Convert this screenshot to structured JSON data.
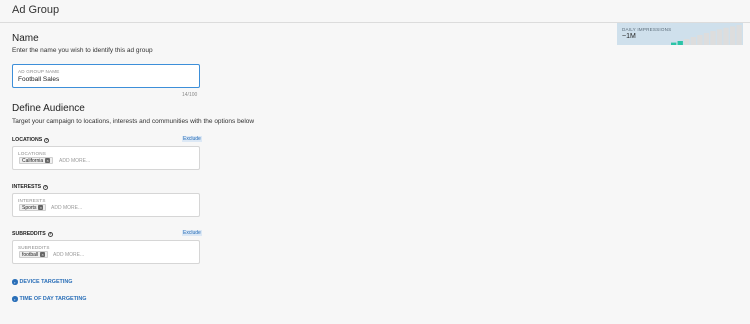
{
  "header": {
    "title": "Ad Group"
  },
  "name_section": {
    "title": "Name",
    "description": "Enter the name you wish to identify this ad group",
    "input": {
      "label": "AD GROUP NAME",
      "value": "Football Sales",
      "char_count": "14/100"
    }
  },
  "audience_section": {
    "title": "Define Audience",
    "description": "Target your campaign to locations, interests and communities with the options below"
  },
  "locations": {
    "heading": "LOCATIONS",
    "exclude_label": "Exclude",
    "field_label": "LOCATIONS",
    "tags": [
      "California"
    ],
    "add_more": "ADD MORE..."
  },
  "interests": {
    "heading": "INTERESTS",
    "field_label": "INTERESTS",
    "tags": [
      "Sports"
    ],
    "add_more": "ADD MORE..."
  },
  "subreddits": {
    "heading": "SUBREDDITS",
    "exclude_label": "Exclude",
    "field_label": "SUBREDDITS",
    "tags": [
      "football"
    ],
    "add_more": "ADD MORE..."
  },
  "targeting_links": {
    "device": "DEVICE TARGETING",
    "time_of_day": "TIME OF DAY TARGETING"
  },
  "impressions": {
    "label": "DAILY IMPRESSIONS",
    "value": "~1M",
    "active_color": "#2bc4a6",
    "inactive_color": "#dddddd",
    "bar_levels": [
      0.12,
      0.2,
      0.3,
      0.4,
      0.5,
      0.6,
      0.7,
      0.78,
      0.86,
      0.93,
      1.0
    ],
    "active_count": 2
  },
  "icons": {
    "help": "help-circle-icon",
    "chevron": "chevron-right-circle-icon",
    "remove": "close-icon"
  }
}
